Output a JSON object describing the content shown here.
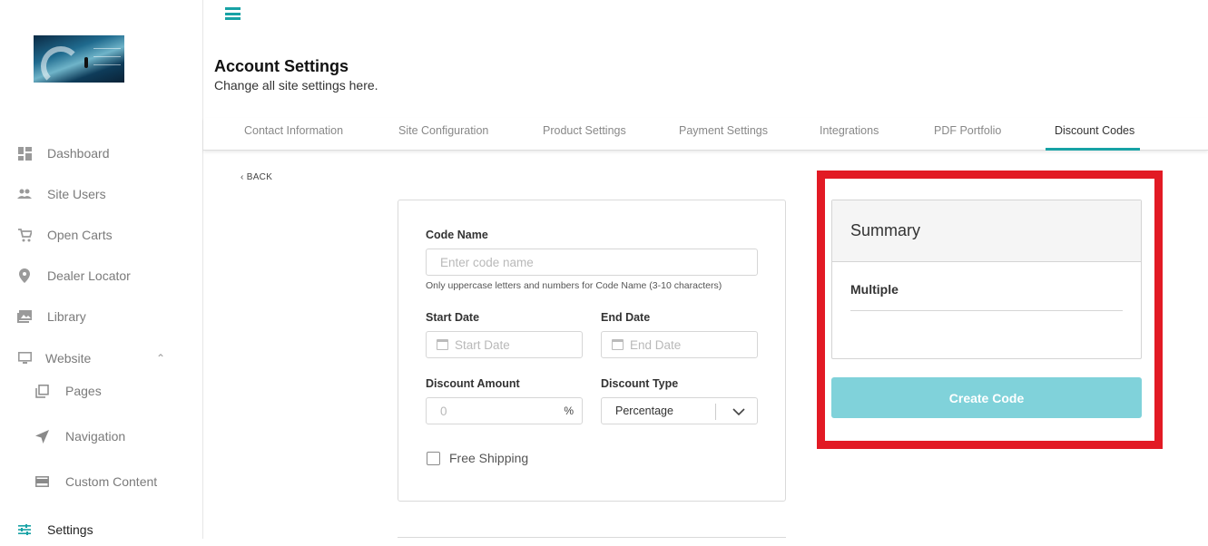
{
  "sidebar": {
    "items": [
      {
        "label": "Dashboard",
        "icon": "dashboard-icon"
      },
      {
        "label": "Site Users",
        "icon": "users-icon"
      },
      {
        "label": "Open Carts",
        "icon": "cart-icon"
      },
      {
        "label": "Dealer Locator",
        "icon": "location-pin-icon"
      },
      {
        "label": "Library",
        "icon": "photo-library-icon"
      },
      {
        "label": "Website",
        "icon": "monitor-icon"
      },
      {
        "label": "Pages",
        "icon": "pages-icon"
      },
      {
        "label": "Navigation",
        "icon": "navigation-arrow-icon"
      },
      {
        "label": "Custom Content",
        "icon": "custom-content-icon"
      },
      {
        "label": "Settings",
        "icon": "settings-sliders-icon"
      }
    ]
  },
  "header": {
    "title": "Account Settings",
    "subtitle": "Change all site settings here."
  },
  "tabs": [
    "Contact Information",
    "Site Configuration",
    "Product Settings",
    "Payment Settings",
    "Integrations",
    "PDF Portfolio",
    "Discount Codes"
  ],
  "active_tab": "Discount Codes",
  "back_label": "BACK",
  "form": {
    "code_name_label": "Code Name",
    "code_name_placeholder": "Enter code name",
    "code_name_hint": "Only uppercase letters and numbers for Code Name (3-10 characters)",
    "start_date_label": "Start Date",
    "start_date_placeholder": "Start Date",
    "end_date_label": "End Date",
    "end_date_placeholder": "End Date",
    "discount_amount_label": "Discount Amount",
    "discount_amount_placeholder": "0",
    "discount_amount_unit": "%",
    "discount_type_label": "Discount Type",
    "discount_type_value": "Percentage",
    "free_shipping_label": "Free Shipping"
  },
  "summary": {
    "title": "Summary",
    "item": "Multiple"
  },
  "create_button_label": "Create Code",
  "colors": {
    "accent": "#17a2a5",
    "button": "#80d2da",
    "highlight": "#e21a24"
  }
}
